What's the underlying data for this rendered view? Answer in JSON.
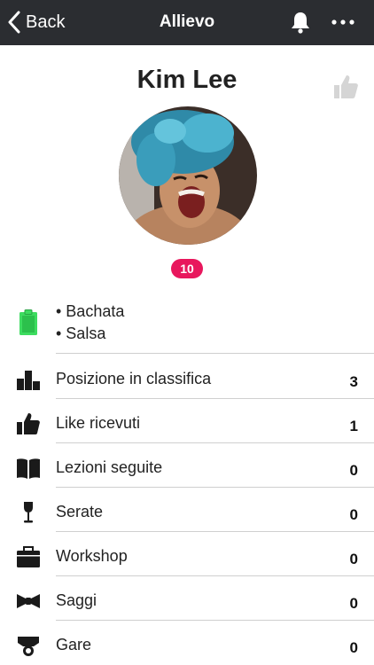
{
  "navbar": {
    "back_label": "Back",
    "title": "Allievo"
  },
  "profile": {
    "name": "Kim Lee",
    "badge_count": "10"
  },
  "dance_styles": [
    "• Bachata",
    "• Salsa"
  ],
  "stats": [
    {
      "icon": "ranking-bars-icon",
      "label": "Posizione in classifica",
      "value": "3"
    },
    {
      "icon": "thumbs-up-icon",
      "label": "Like ricevuti",
      "value": "1"
    },
    {
      "icon": "open-book-icon",
      "label": "Lezioni seguite",
      "value": "0"
    },
    {
      "icon": "wine-glass-icon",
      "label": "Serate",
      "value": "0"
    },
    {
      "icon": "briefcase-icon",
      "label": "Workshop",
      "value": "0"
    },
    {
      "icon": "bow-tie-icon",
      "label": "Saggi",
      "value": "0"
    },
    {
      "icon": "medal-icon",
      "label": "Gare",
      "value": "0"
    }
  ],
  "colors": {
    "navbar_bg": "#2b2d31",
    "badge": "#e8175d",
    "clipboard": "#3ddc5f"
  }
}
